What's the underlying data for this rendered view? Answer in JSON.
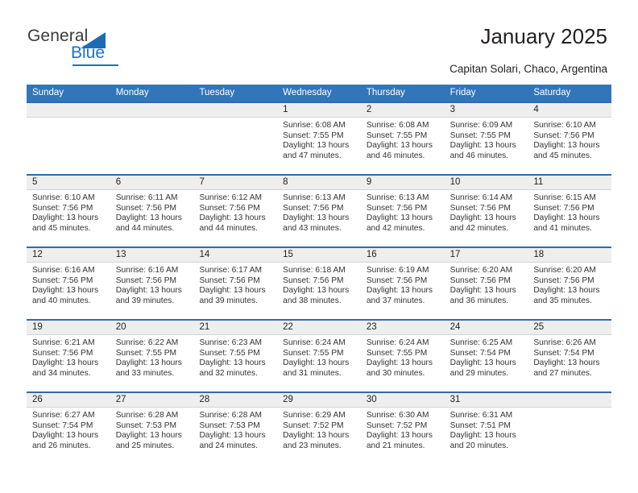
{
  "brand": {
    "name_part1": "General",
    "name_part2": "Blue",
    "flag_icon": "triangle-flag-icon"
  },
  "header": {
    "title": "January 2025",
    "location": "Capitan Solari, Chaco, Argentina"
  },
  "calendar": {
    "weekdays": [
      "Sunday",
      "Monday",
      "Tuesday",
      "Wednesday",
      "Thursday",
      "Friday",
      "Saturday"
    ],
    "accent_color": "#3275bb",
    "day_band_color": "#eeeeee",
    "weeks": [
      [
        {
          "day": "",
          "lines": []
        },
        {
          "day": "",
          "lines": []
        },
        {
          "day": "",
          "lines": []
        },
        {
          "day": "1",
          "lines": [
            "Sunrise: 6:08 AM",
            "Sunset: 7:55 PM",
            "Daylight: 13 hours",
            "and 47 minutes."
          ]
        },
        {
          "day": "2",
          "lines": [
            "Sunrise: 6:08 AM",
            "Sunset: 7:55 PM",
            "Daylight: 13 hours",
            "and 46 minutes."
          ]
        },
        {
          "day": "3",
          "lines": [
            "Sunrise: 6:09 AM",
            "Sunset: 7:55 PM",
            "Daylight: 13 hours",
            "and 46 minutes."
          ]
        },
        {
          "day": "4",
          "lines": [
            "Sunrise: 6:10 AM",
            "Sunset: 7:56 PM",
            "Daylight: 13 hours",
            "and 45 minutes."
          ]
        }
      ],
      [
        {
          "day": "5",
          "lines": [
            "Sunrise: 6:10 AM",
            "Sunset: 7:56 PM",
            "Daylight: 13 hours",
            "and 45 minutes."
          ]
        },
        {
          "day": "6",
          "lines": [
            "Sunrise: 6:11 AM",
            "Sunset: 7:56 PM",
            "Daylight: 13 hours",
            "and 44 minutes."
          ]
        },
        {
          "day": "7",
          "lines": [
            "Sunrise: 6:12 AM",
            "Sunset: 7:56 PM",
            "Daylight: 13 hours",
            "and 44 minutes."
          ]
        },
        {
          "day": "8",
          "lines": [
            "Sunrise: 6:13 AM",
            "Sunset: 7:56 PM",
            "Daylight: 13 hours",
            "and 43 minutes."
          ]
        },
        {
          "day": "9",
          "lines": [
            "Sunrise: 6:13 AM",
            "Sunset: 7:56 PM",
            "Daylight: 13 hours",
            "and 42 minutes."
          ]
        },
        {
          "day": "10",
          "lines": [
            "Sunrise: 6:14 AM",
            "Sunset: 7:56 PM",
            "Daylight: 13 hours",
            "and 42 minutes."
          ]
        },
        {
          "day": "11",
          "lines": [
            "Sunrise: 6:15 AM",
            "Sunset: 7:56 PM",
            "Daylight: 13 hours",
            "and 41 minutes."
          ]
        }
      ],
      [
        {
          "day": "12",
          "lines": [
            "Sunrise: 6:16 AM",
            "Sunset: 7:56 PM",
            "Daylight: 13 hours",
            "and 40 minutes."
          ]
        },
        {
          "day": "13",
          "lines": [
            "Sunrise: 6:16 AM",
            "Sunset: 7:56 PM",
            "Daylight: 13 hours",
            "and 39 minutes."
          ]
        },
        {
          "day": "14",
          "lines": [
            "Sunrise: 6:17 AM",
            "Sunset: 7:56 PM",
            "Daylight: 13 hours",
            "and 39 minutes."
          ]
        },
        {
          "day": "15",
          "lines": [
            "Sunrise: 6:18 AM",
            "Sunset: 7:56 PM",
            "Daylight: 13 hours",
            "and 38 minutes."
          ]
        },
        {
          "day": "16",
          "lines": [
            "Sunrise: 6:19 AM",
            "Sunset: 7:56 PM",
            "Daylight: 13 hours",
            "and 37 minutes."
          ]
        },
        {
          "day": "17",
          "lines": [
            "Sunrise: 6:20 AM",
            "Sunset: 7:56 PM",
            "Daylight: 13 hours",
            "and 36 minutes."
          ]
        },
        {
          "day": "18",
          "lines": [
            "Sunrise: 6:20 AM",
            "Sunset: 7:56 PM",
            "Daylight: 13 hours",
            "and 35 minutes."
          ]
        }
      ],
      [
        {
          "day": "19",
          "lines": [
            "Sunrise: 6:21 AM",
            "Sunset: 7:56 PM",
            "Daylight: 13 hours",
            "and 34 minutes."
          ]
        },
        {
          "day": "20",
          "lines": [
            "Sunrise: 6:22 AM",
            "Sunset: 7:55 PM",
            "Daylight: 13 hours",
            "and 33 minutes."
          ]
        },
        {
          "day": "21",
          "lines": [
            "Sunrise: 6:23 AM",
            "Sunset: 7:55 PM",
            "Daylight: 13 hours",
            "and 32 minutes."
          ]
        },
        {
          "day": "22",
          "lines": [
            "Sunrise: 6:24 AM",
            "Sunset: 7:55 PM",
            "Daylight: 13 hours",
            "and 31 minutes."
          ]
        },
        {
          "day": "23",
          "lines": [
            "Sunrise: 6:24 AM",
            "Sunset: 7:55 PM",
            "Daylight: 13 hours",
            "and 30 minutes."
          ]
        },
        {
          "day": "24",
          "lines": [
            "Sunrise: 6:25 AM",
            "Sunset: 7:54 PM",
            "Daylight: 13 hours",
            "and 29 minutes."
          ]
        },
        {
          "day": "25",
          "lines": [
            "Sunrise: 6:26 AM",
            "Sunset: 7:54 PM",
            "Daylight: 13 hours",
            "and 27 minutes."
          ]
        }
      ],
      [
        {
          "day": "26",
          "lines": [
            "Sunrise: 6:27 AM",
            "Sunset: 7:54 PM",
            "Daylight: 13 hours",
            "and 26 minutes."
          ]
        },
        {
          "day": "27",
          "lines": [
            "Sunrise: 6:28 AM",
            "Sunset: 7:53 PM",
            "Daylight: 13 hours",
            "and 25 minutes."
          ]
        },
        {
          "day": "28",
          "lines": [
            "Sunrise: 6:28 AM",
            "Sunset: 7:53 PM",
            "Daylight: 13 hours",
            "and 24 minutes."
          ]
        },
        {
          "day": "29",
          "lines": [
            "Sunrise: 6:29 AM",
            "Sunset: 7:52 PM",
            "Daylight: 13 hours",
            "and 23 minutes."
          ]
        },
        {
          "day": "30",
          "lines": [
            "Sunrise: 6:30 AM",
            "Sunset: 7:52 PM",
            "Daylight: 13 hours",
            "and 21 minutes."
          ]
        },
        {
          "day": "31",
          "lines": [
            "Sunrise: 6:31 AM",
            "Sunset: 7:51 PM",
            "Daylight: 13 hours",
            "and 20 minutes."
          ]
        },
        {
          "day": "",
          "lines": []
        }
      ]
    ]
  }
}
